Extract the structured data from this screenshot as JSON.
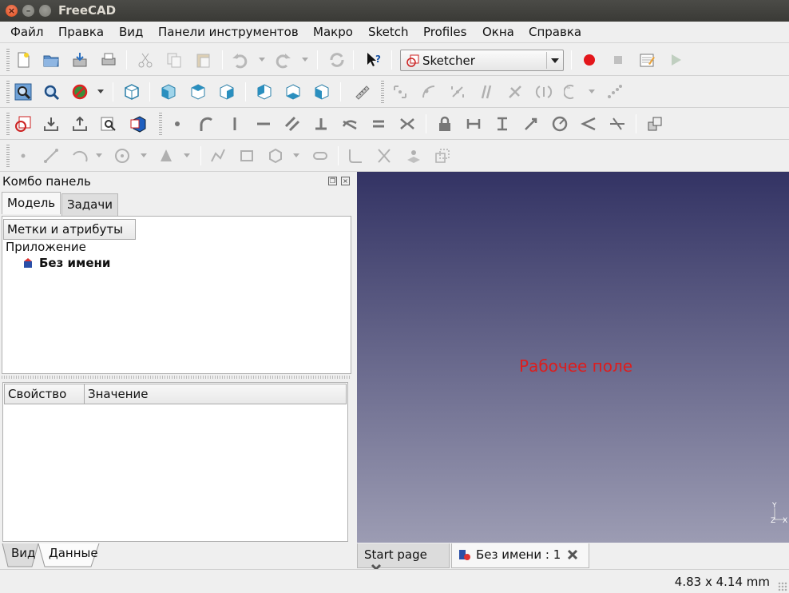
{
  "window": {
    "title": "FreeCAD"
  },
  "menu": [
    "Файл",
    "Правка",
    "Вид",
    "Панели инструментов",
    "Макро",
    "Sketch",
    "Profiles",
    "Окна",
    "Справка"
  ],
  "workbench": {
    "selected": "Sketcher"
  },
  "combo": {
    "title": "Комбо панель",
    "tabs": [
      "Модель",
      "Задачи"
    ],
    "tree_header": "Метки и атрибуты",
    "tree": {
      "root": "Приложение",
      "document": "Без имени"
    },
    "property_headers": [
      "Свойство",
      "Значение"
    ],
    "bottom_tabs": [
      "Вид",
      "Данные"
    ]
  },
  "view": {
    "placeholder": "Рабочее поле",
    "axes": {
      "y": "Y",
      "z": "Z",
      "x": "X"
    }
  },
  "doc_tabs": [
    "Start page",
    "Без имени : 1"
  ],
  "status": {
    "dimensions": "4.83 x 4.14 mm"
  },
  "colors": {
    "titlebar": "#3c3b37",
    "view_top": "#333364",
    "view_bottom": "#9c9cb3",
    "placeholder": "#dd1d1d",
    "record": "#e3161b"
  }
}
